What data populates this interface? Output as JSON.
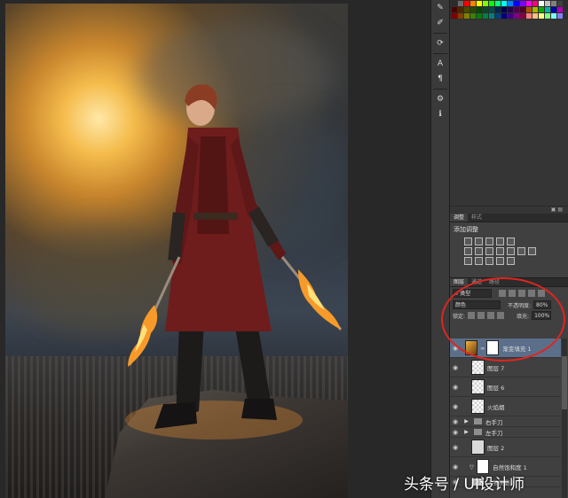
{
  "colors": {
    "ui_dark": "#282828",
    "panel_bg": "#404040",
    "selection": "#5b6f8a",
    "annotation": "#e0251f"
  },
  "swatches": [
    [
      "#2b2b2b",
      "#6a6a6a",
      "#ff0000",
      "#ff7f00",
      "#ffff00",
      "#7fff00",
      "#00ff00",
      "#00ff7f",
      "#00ffff",
      "#007fff",
      "#0000ff",
      "#7f00ff",
      "#ff00ff",
      "#ff007f",
      "#ffffff",
      "#c0c0c0",
      "#808080",
      "#404040"
    ],
    [
      "#4b0000",
      "#4b2600",
      "#4b4b00",
      "#264b00",
      "#004b00",
      "#004b26",
      "#004b4b",
      "#00264b",
      "#00004b",
      "#26004b",
      "#4b004b",
      "#4b0026",
      "#b05000",
      "#b0b000",
      "#00b000",
      "#00b0b0",
      "#0000b0",
      "#b000b0"
    ],
    [
      "#800000",
      "#804000",
      "#808000",
      "#408000",
      "#008000",
      "#008040",
      "#008080",
      "#004080",
      "#000080",
      "#400080",
      "#800080",
      "#800040",
      "#ff8080",
      "#ffc080",
      "#ffff80",
      "#80ff80",
      "#80ffff",
      "#8080ff"
    ]
  ],
  "tools": [
    {
      "icon": "stamp-icon",
      "glyph": "✎"
    },
    {
      "icon": "brush-icon",
      "glyph": "✐"
    },
    {
      "icon": "rotate-icon",
      "glyph": "⟳"
    },
    {
      "icon": "text-icon",
      "glyph": "A"
    },
    {
      "icon": "paragraph-icon",
      "glyph": "¶"
    },
    {
      "icon": "settings-icon",
      "glyph": "⚙"
    },
    {
      "icon": "info-icon",
      "glyph": "ℹ"
    }
  ],
  "adjustments_panel": {
    "tabs": [
      "调整",
      "样式"
    ],
    "title": "添加调整"
  },
  "layers_panel": {
    "tabs": [
      "图层",
      "通道",
      "路径"
    ],
    "filter_kind": "类型",
    "blend_mode": "颜色",
    "opacity_label": "不透明度:",
    "opacity_value": "80%",
    "lock_label": "锁定:",
    "fill_label": "填充:",
    "fill_value": "100%",
    "layers": [
      {
        "name": "渐变填充 1",
        "kind": "gradient",
        "selected": true
      },
      {
        "name": "图层 7",
        "kind": "normal"
      },
      {
        "name": "图层 6",
        "kind": "normal"
      },
      {
        "name": "火焰烟",
        "kind": "normal"
      },
      {
        "name": "右手刀",
        "kind": "group"
      },
      {
        "name": "左手刀",
        "kind": "group"
      },
      {
        "name": "图层 2",
        "kind": "normal"
      },
      {
        "name": "自然饱和度 1",
        "kind": "adjustment"
      },
      {
        "name": "人物阴影2",
        "kind": "normal"
      }
    ]
  },
  "watermark": "头条号 / UI设计师"
}
